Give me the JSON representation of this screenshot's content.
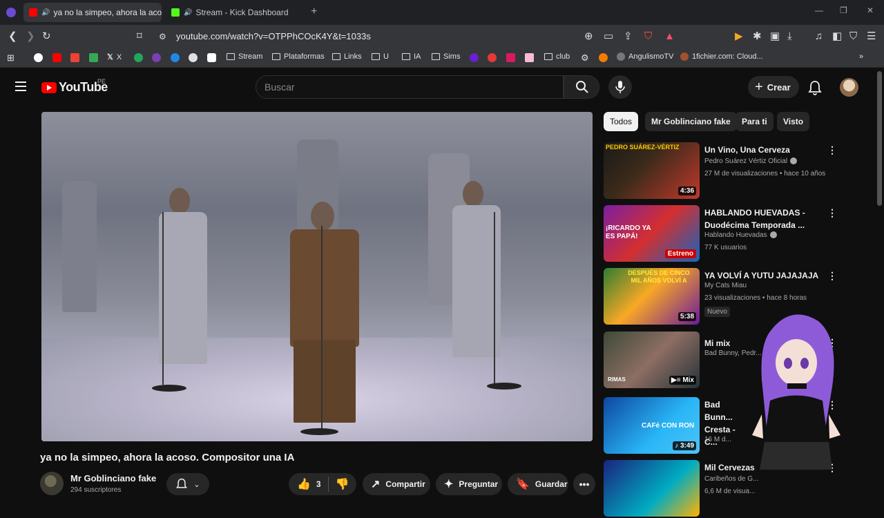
{
  "browser": {
    "tabs": [
      {
        "title": "ya no la simpeo, ahora la acoso",
        "active": true
      },
      {
        "title": "Stream - Kick Dashboard",
        "active": false
      }
    ],
    "url": "youtube.com/watch?v=OTPPhCOcK4Y&t=1033s",
    "bookmarks": [
      "X",
      "Stream",
      "Plataformas",
      "Links",
      "U",
      "IA",
      "Sims",
      "club",
      "AngulismoTV",
      "1fichier.com: Cloud..."
    ]
  },
  "header": {
    "logo": "YouTube",
    "country": "PE",
    "search_placeholder": "Buscar",
    "create_label": "Crear"
  },
  "video": {
    "title": "ya no la simpeo, ahora la acoso. Compositor una IA",
    "channel": "Mr Goblinciano fake",
    "subscribers": "294 suscriptores",
    "likes": "3",
    "share_label": "Compartir",
    "ask_label": "Preguntar",
    "save_label": "Guardar"
  },
  "chips": [
    "Todos",
    "Mr Goblinciano fake",
    "Para ti",
    "Visto"
  ],
  "recommendations": [
    {
      "title": "Un Vino, Una Cerveza",
      "channel": "Pedro Suárez Vértiz Oficial",
      "verified": true,
      "meta": "27 M de visualizaciones • hace 10 años",
      "duration": "4:36",
      "thumb_text": "PEDRO SUÁREZ-VÉRTIZ"
    },
    {
      "title": "HABLANDO HUEVADAS - Duodécima Temporada ...",
      "channel": "Hablando Huevadas",
      "verified": true,
      "meta": "77 K usuarios",
      "badge_live": "Estreno",
      "thumb_text": "¡RICARDO YA ES PAPÁ!"
    },
    {
      "title": "YA VOLVÍ A YUTU JAJAJAJA",
      "channel": "My Cats Miau",
      "verified": false,
      "meta": "23 visualizaciones • hace 8 horas",
      "badge": "Nuevo",
      "duration": "5:38",
      "thumb_text": "DESPUÉS DE CINCO MIL AÑOS VOLVÍ A"
    },
    {
      "title": "Mi mix",
      "channel": "Bad Bunny, Pedr...",
      "verified": false,
      "meta": "",
      "duration": "Mix",
      "thumb_text": "RIMAS"
    },
    {
      "title": "Bad Bunn... Cresta - C...",
      "channel": "",
      "verified": false,
      "meta": "16 M d...",
      "duration": "3:49",
      "thumb_text": "CAFé CON RON"
    },
    {
      "title": "Mil Cervezas",
      "channel": "Caribeños de G...",
      "verified": false,
      "meta": "6,6 M de visua...",
      "thumb_text": ""
    }
  ],
  "colors": {
    "bg": "#0f0f0f",
    "surface": "#272727",
    "accent": "#ff0000"
  }
}
